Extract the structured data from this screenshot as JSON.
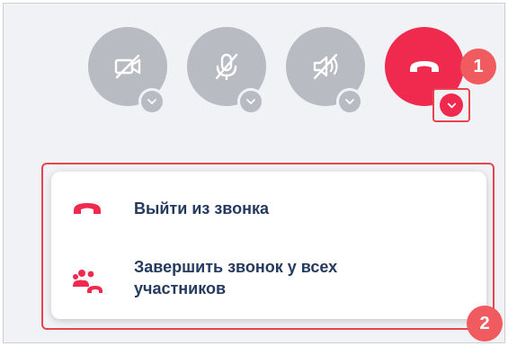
{
  "controls": {
    "camera": {
      "icon": "camera-off-icon",
      "menu_icon": "chevron-down-icon"
    },
    "microphone": {
      "icon": "microphone-off-icon",
      "menu_icon": "chevron-down-icon"
    },
    "speaker": {
      "icon": "speaker-off-icon",
      "menu_icon": "chevron-down-icon"
    },
    "hangup": {
      "icon": "phone-hangup-icon",
      "menu_icon": "chevron-down-icon"
    }
  },
  "callouts": {
    "first": "1",
    "second": "2"
  },
  "hangup_menu": {
    "items": [
      {
        "label": "Выйти из звонка",
        "icon": "phone-hangup-icon"
      },
      {
        "label_line1": "Завершить звонок у всех",
        "label_line2": "участников",
        "icon": "people-hangup-icon"
      }
    ]
  },
  "colors": {
    "control_bg": "#b9bbc3",
    "hangup_bg": "#f0294f",
    "callout_bg": "#ef5b5e",
    "highlight_border": "#e6454f",
    "menu_text": "#243a5e"
  }
}
